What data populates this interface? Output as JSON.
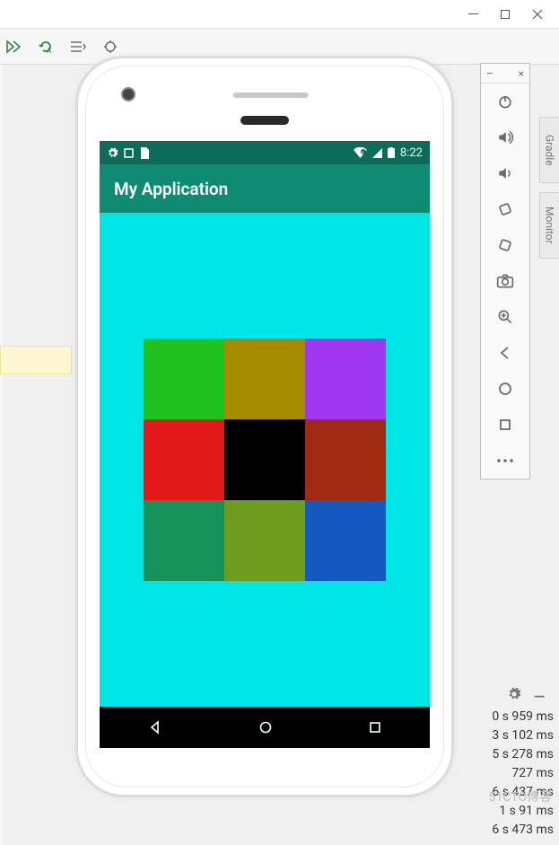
{
  "os_window": {
    "minimize": "—",
    "maximize": "▢",
    "close": "✕"
  },
  "android": {
    "status_time": "8:22",
    "app_title": "My Application"
  },
  "grid_colors": [
    "#1fc21f",
    "#a58b00",
    "#a038f2",
    "#e21919",
    "#000000",
    "#a02a12",
    "#16935a",
    "#6e9c1f",
    "#1559c0"
  ],
  "emulator": {
    "minimize": "–",
    "close": "×"
  },
  "logs": [
    "0 s 959 ms",
    "3 s 102 ms",
    "5 s 278 ms",
    "727 ms",
    "6 s 437 ms",
    "1 s 91 ms",
    "6 s 473 ms"
  ],
  "watermark": "51CTO博客",
  "side_tabs": [
    "Gradle",
    "Monitor"
  ]
}
